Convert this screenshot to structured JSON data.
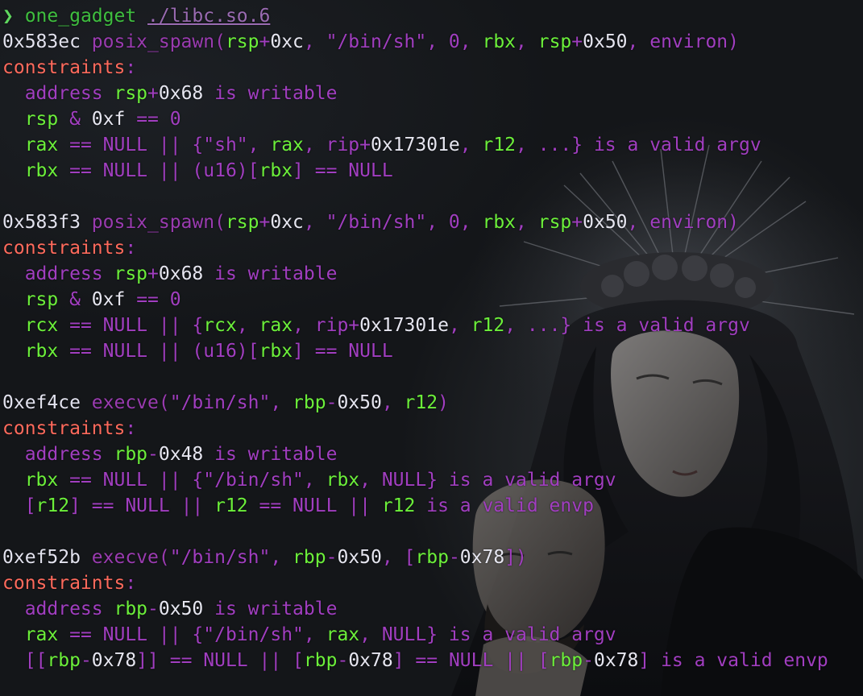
{
  "colors": {
    "prompt": "#5fd75f",
    "command": "#3fbf3f",
    "path": "#9a6bb2",
    "address": "#e2e2ee",
    "function": "#9a3bb0",
    "register": "#6cf03a",
    "operator": "#a13ec0",
    "number": "#e6e6f0",
    "string": "#a13ec0",
    "constraints_label": "#ff6a5c",
    "keyword": "#a13ec0",
    "background": "#141619"
  },
  "wallpaper_icon": "gothic-madonna-pieta-icon",
  "lines": [
    [
      [
        "prompt",
        "❯ "
      ],
      [
        "cmd",
        "one_gadget "
      ],
      [
        "path",
        "./libc.so.6"
      ]
    ],
    [
      [
        "addr",
        "0x583ec "
      ],
      [
        "func",
        "posix_spawn("
      ],
      [
        "reg",
        "rsp"
      ],
      [
        "op",
        "+"
      ],
      [
        "num",
        "0xc"
      ],
      [
        "op",
        ", "
      ],
      [
        "str",
        "\"/bin/sh\""
      ],
      [
        "op",
        ", 0, "
      ],
      [
        "reg",
        "rbx"
      ],
      [
        "op",
        ", "
      ],
      [
        "reg",
        "rsp"
      ],
      [
        "op",
        "+"
      ],
      [
        "num",
        "0x50"
      ],
      [
        "op",
        ", environ)"
      ]
    ],
    [
      [
        "key",
        "constraints"
      ],
      [
        "op",
        ":"
      ]
    ],
    [
      [
        "op",
        "  address "
      ],
      [
        "reg",
        "rsp"
      ],
      [
        "op",
        "+"
      ],
      [
        "num",
        "0x68"
      ],
      [
        "op",
        " is writable"
      ]
    ],
    [
      [
        "op",
        "  "
      ],
      [
        "reg",
        "rsp"
      ],
      [
        "op",
        " & "
      ],
      [
        "num",
        "0xf"
      ],
      [
        "op",
        " == 0"
      ]
    ],
    [
      [
        "op",
        "  "
      ],
      [
        "reg",
        "rax"
      ],
      [
        "op",
        " == NULL || {\"sh\", "
      ],
      [
        "reg",
        "rax"
      ],
      [
        "op",
        ", rip+"
      ],
      [
        "num",
        "0x17301e"
      ],
      [
        "op",
        ", "
      ],
      [
        "reg",
        "r12"
      ],
      [
        "op",
        ", ...} is a valid argv"
      ]
    ],
    [
      [
        "op",
        "  "
      ],
      [
        "reg",
        "rbx"
      ],
      [
        "op",
        " == NULL || (u16)["
      ],
      [
        "reg",
        "rbx"
      ],
      [
        "op",
        "] == NULL"
      ]
    ],
    [],
    [
      [
        "addr",
        "0x583f3 "
      ],
      [
        "func",
        "posix_spawn("
      ],
      [
        "reg",
        "rsp"
      ],
      [
        "op",
        "+"
      ],
      [
        "num",
        "0xc"
      ],
      [
        "op",
        ", "
      ],
      [
        "str",
        "\"/bin/sh\""
      ],
      [
        "op",
        ", 0, "
      ],
      [
        "reg",
        "rbx"
      ],
      [
        "op",
        ", "
      ],
      [
        "reg",
        "rsp"
      ],
      [
        "op",
        "+"
      ],
      [
        "num",
        "0x50"
      ],
      [
        "op",
        ", environ)"
      ]
    ],
    [
      [
        "key",
        "constraints"
      ],
      [
        "op",
        ":"
      ]
    ],
    [
      [
        "op",
        "  address "
      ],
      [
        "reg",
        "rsp"
      ],
      [
        "op",
        "+"
      ],
      [
        "num",
        "0x68"
      ],
      [
        "op",
        " is writable"
      ]
    ],
    [
      [
        "op",
        "  "
      ],
      [
        "reg",
        "rsp"
      ],
      [
        "op",
        " & "
      ],
      [
        "num",
        "0xf"
      ],
      [
        "op",
        " == 0"
      ]
    ],
    [
      [
        "op",
        "  "
      ],
      [
        "reg",
        "rcx"
      ],
      [
        "op",
        " == NULL || {"
      ],
      [
        "reg",
        "rcx"
      ],
      [
        "op",
        ", "
      ],
      [
        "reg",
        "rax"
      ],
      [
        "op",
        ", rip+"
      ],
      [
        "num",
        "0x17301e"
      ],
      [
        "op",
        ", "
      ],
      [
        "reg",
        "r12"
      ],
      [
        "op",
        ", ...} is a valid argv"
      ]
    ],
    [
      [
        "op",
        "  "
      ],
      [
        "reg",
        "rbx"
      ],
      [
        "op",
        " == NULL || (u16)["
      ],
      [
        "reg",
        "rbx"
      ],
      [
        "op",
        "] == NULL"
      ]
    ],
    [],
    [
      [
        "addr",
        "0xef4ce "
      ],
      [
        "func",
        "execve("
      ],
      [
        "str",
        "\"/bin/sh\""
      ],
      [
        "op",
        ", "
      ],
      [
        "reg",
        "rbp"
      ],
      [
        "op",
        "-"
      ],
      [
        "num",
        "0x50"
      ],
      [
        "op",
        ", "
      ],
      [
        "reg",
        "r12"
      ],
      [
        "op",
        ")"
      ]
    ],
    [
      [
        "key",
        "constraints"
      ],
      [
        "op",
        ":"
      ]
    ],
    [
      [
        "op",
        "  address "
      ],
      [
        "reg",
        "rbp"
      ],
      [
        "op",
        "-"
      ],
      [
        "num",
        "0x48"
      ],
      [
        "op",
        " is writable"
      ]
    ],
    [
      [
        "op",
        "  "
      ],
      [
        "reg",
        "rbx"
      ],
      [
        "op",
        " == NULL || {\"/bin/sh\", "
      ],
      [
        "reg",
        "rbx"
      ],
      [
        "op",
        ", NULL} is a valid argv"
      ]
    ],
    [
      [
        "op",
        "  ["
      ],
      [
        "reg",
        "r12"
      ],
      [
        "op",
        "] == NULL || "
      ],
      [
        "reg",
        "r12"
      ],
      [
        "op",
        " == NULL || "
      ],
      [
        "reg",
        "r12"
      ],
      [
        "op",
        " is a valid envp"
      ]
    ],
    [],
    [
      [
        "addr",
        "0xef52b "
      ],
      [
        "func",
        "execve("
      ],
      [
        "str",
        "\"/bin/sh\""
      ],
      [
        "op",
        ", "
      ],
      [
        "reg",
        "rbp"
      ],
      [
        "op",
        "-"
      ],
      [
        "num",
        "0x50"
      ],
      [
        "op",
        ", ["
      ],
      [
        "reg",
        "rbp"
      ],
      [
        "op",
        "-"
      ],
      [
        "num",
        "0x78"
      ],
      [
        "op",
        "])"
      ]
    ],
    [
      [
        "key",
        "constraints"
      ],
      [
        "op",
        ":"
      ]
    ],
    [
      [
        "op",
        "  address "
      ],
      [
        "reg",
        "rbp"
      ],
      [
        "op",
        "-"
      ],
      [
        "num",
        "0x50"
      ],
      [
        "op",
        " is writable"
      ]
    ],
    [
      [
        "op",
        "  "
      ],
      [
        "reg",
        "rax"
      ],
      [
        "op",
        " == NULL || {\"/bin/sh\", "
      ],
      [
        "reg",
        "rax"
      ],
      [
        "op",
        ", NULL} is a valid argv"
      ]
    ],
    [
      [
        "op",
        "  [["
      ],
      [
        "reg",
        "rbp"
      ],
      [
        "op",
        "-"
      ],
      [
        "num",
        "0x78"
      ],
      [
        "op",
        "]] == NULL || ["
      ],
      [
        "reg",
        "rbp"
      ],
      [
        "op",
        "-"
      ],
      [
        "num",
        "0x78"
      ],
      [
        "op",
        "] == NULL || ["
      ],
      [
        "reg",
        "rbp"
      ],
      [
        "op",
        "-"
      ],
      [
        "num",
        "0x78"
      ],
      [
        "op",
        "] is a valid envp"
      ]
    ]
  ]
}
